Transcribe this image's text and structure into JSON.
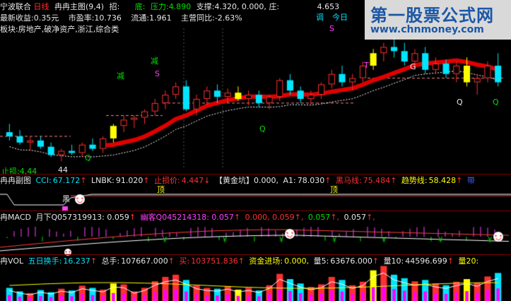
{
  "header": {
    "stock_title": "宁波联合",
    "period": "日线",
    "main_indicator": "冉冉主图(9,4)",
    "zhao_label": "招:",
    "zhao_value": "",
    "di_label": "底:",
    "pressure_label": "压力:",
    "pressure_value": "4.890",
    "support_label": "支撑:",
    "support_value": "4.320, 0.000,",
    "zhuang_label": "庄:",
    "zhuang_value": "4.653"
  },
  "info": {
    "eps": "最新收益:0.35元",
    "pe": "市盈率:10.736",
    "float": "流通:1.961",
    "rev_yoy_label": "主营同比:",
    "rev_yoy_value": "-2.63%",
    "sectors": "板块:房地产,破净资产,浙江,综合类"
  },
  "main_chart": {
    "signals": {
      "jian1": "减",
      "jian2": "减",
      "s1": "S",
      "s2": "S",
      "q1": "Q",
      "q2": "Q",
      "q3": "Q",
      "q4": "Q",
      "t": "T",
      "g": "G",
      "tiao": "调",
      "ri": "今日"
    },
    "stoploss_text": "止损:4.44",
    "stoploss_value": "44"
  },
  "sub1": {
    "name": "冉冉副图",
    "cci_label": "CCI:",
    "cci_value": "67.172",
    "lnbk_label": "LNBK:",
    "lnbk_value": "91.020",
    "stop_label": "止损价:",
    "stop_value": "4.447",
    "pit_label": "【黄金坑】",
    "pit_value": "0.000,",
    "a1_label": "A1:",
    "a1_value": "78.030",
    "horse_label": "黑马线:",
    "horse_value": "75.484",
    "trend_label": "趋势线:",
    "trend_value": "58.428",
    "extra": "带",
    "top1": "顶",
    "top2": "顶",
    "black": "黑"
  },
  "sub2": {
    "name": "冉MACD",
    "l1_label": "月下Q",
    "l1_value": "057319913: 0.059",
    "l2_label": "幽客Q",
    "l2_value": "045214318: 0.057",
    "v3": "0.000, 0.059",
    "v4": "0.057",
    "v5": "0.057"
  },
  "sub3": {
    "name": "冉VOL",
    "turn5_label": "五日换手:",
    "turn5_value": "16.237",
    "total_label": "总手:",
    "total_value": "107667.000",
    "buy_label": "买:",
    "buy_value": "103751.836",
    "fund_label": "资金进场:",
    "fund_value": "0.000,",
    "v5_label": "量5:",
    "v5_value": "63676.000",
    "v10_label": "量10:",
    "v10_value": "44596.699",
    "v20_label": "量20:"
  },
  "watermark": {
    "title": "第一股票公式网",
    "url": "www.chnmoney.com"
  },
  "colors": {
    "up": "#ff3030",
    "down": "#00e5ff",
    "yellow": "#ffff00",
    "band": "#e00000",
    "white_line": "#ffffff",
    "magenta": "#ff40ff",
    "green": "#00e000"
  },
  "candles": [
    [
      4.52,
      4.56,
      4.48,
      4.5
    ],
    [
      4.5,
      4.53,
      4.46,
      4.47
    ],
    [
      4.47,
      4.5,
      4.43,
      4.48
    ],
    [
      4.48,
      4.5,
      4.44,
      4.45
    ],
    [
      4.45,
      4.47,
      4.4,
      4.41
    ],
    [
      4.41,
      4.44,
      4.38,
      4.43
    ],
    [
      4.43,
      4.46,
      4.41,
      4.42
    ],
    [
      4.42,
      4.47,
      4.4,
      4.46
    ],
    [
      4.46,
      4.49,
      4.43,
      4.44
    ],
    [
      4.44,
      4.5,
      4.42,
      4.49
    ],
    [
      4.49,
      4.56,
      4.47,
      4.55
    ],
    [
      4.55,
      4.6,
      4.52,
      4.58
    ],
    [
      4.58,
      4.6,
      4.54,
      4.59
    ],
    [
      4.59,
      4.63,
      4.56,
      4.62
    ],
    [
      4.62,
      4.68,
      4.6,
      4.66
    ],
    [
      4.66,
      4.72,
      4.63,
      4.7
    ],
    [
      4.7,
      4.76,
      4.68,
      4.74
    ],
    [
      4.74,
      4.77,
      4.62,
      4.63
    ],
    [
      4.63,
      4.7,
      4.6,
      4.68
    ],
    [
      4.68,
      4.74,
      4.65,
      4.72
    ],
    [
      4.72,
      4.75,
      4.66,
      4.69
    ],
    [
      4.69,
      4.73,
      4.66,
      4.71
    ],
    [
      4.71,
      4.74,
      4.67,
      4.68
    ],
    [
      4.68,
      4.72,
      4.65,
      4.7
    ],
    [
      4.7,
      4.72,
      4.64,
      4.66
    ],
    [
      4.66,
      4.7,
      4.63,
      4.69
    ],
    [
      4.69,
      4.78,
      4.67,
      4.77
    ],
    [
      4.77,
      4.8,
      4.7,
      4.72
    ],
    [
      4.72,
      4.74,
      4.66,
      4.68
    ],
    [
      4.68,
      4.72,
      4.65,
      4.7
    ],
    [
      4.7,
      4.76,
      4.68,
      4.75
    ],
    [
      4.75,
      4.82,
      4.73,
      4.8
    ],
    [
      4.8,
      4.84,
      4.74,
      4.76
    ],
    [
      4.76,
      4.8,
      4.72,
      4.78
    ],
    [
      4.78,
      4.86,
      4.76,
      4.84
    ],
    [
      4.84,
      4.92,
      4.82,
      4.9
    ],
    [
      4.9,
      4.95,
      4.86,
      4.93
    ],
    [
      4.93,
      4.98,
      4.88,
      4.91
    ],
    [
      4.91,
      4.95,
      4.84,
      4.86
    ],
    [
      4.86,
      4.92,
      4.82,
      4.9
    ],
    [
      4.9,
      4.93,
      4.8,
      4.82
    ],
    [
      4.82,
      4.88,
      4.8,
      4.85
    ],
    [
      4.85,
      4.87,
      4.78,
      4.8
    ],
    [
      4.8,
      4.86,
      4.76,
      4.84
    ],
    [
      4.84,
      4.88,
      4.74,
      4.76
    ],
    [
      4.76,
      4.8,
      4.7,
      4.78
    ],
    [
      4.78,
      4.86,
      4.76,
      4.84
    ],
    [
      4.84,
      4.9,
      4.74,
      4.76
    ]
  ],
  "volumes": [
    30,
    22,
    18,
    25,
    20,
    28,
    24,
    35,
    30,
    26,
    40,
    38,
    22,
    30,
    45,
    55,
    60,
    48,
    35,
    30,
    28,
    34,
    26,
    30,
    24,
    36,
    62,
    50,
    40,
    32,
    38,
    55,
    48,
    36,
    44,
    70,
    80,
    60,
    52,
    45,
    48,
    40,
    36,
    44,
    50,
    42,
    56,
    64
  ]
}
